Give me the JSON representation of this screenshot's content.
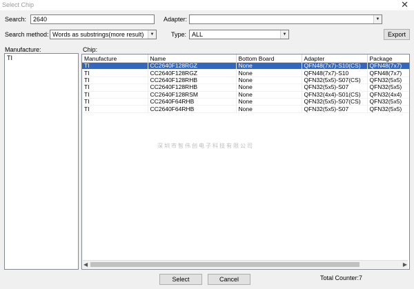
{
  "window": {
    "title": "Select Chip",
    "close_glyph": "✕"
  },
  "search": {
    "label": "Search:",
    "value": "2640"
  },
  "adapter": {
    "label": "Adapter:",
    "value": ""
  },
  "search_method": {
    "label": "Search method:",
    "value": "Words as substrings(more result)"
  },
  "type": {
    "label": "Type:",
    "value": "ALL"
  },
  "export_label": "Export",
  "manufacture": {
    "label": "Manufacture:",
    "items": [
      "TI"
    ]
  },
  "chip": {
    "label": "Chip:",
    "columns": [
      "Manufacture",
      "Name",
      "Bottom Board",
      "Adapter",
      "Package"
    ],
    "rows": [
      [
        "TI",
        "CC2640F128RGZ",
        "None",
        "QFN48(7x7)-S10(CS)",
        "QFN48(7x7)"
      ],
      [
        "TI",
        "CC2640F128RGZ",
        "None",
        "QFN48(7x7)-S10",
        "QFN48(7x7)"
      ],
      [
        "TI",
        "CC2640F128RHB",
        "None",
        "QFN32(5x5)-S07(CS)",
        "QFN32(5x5)"
      ],
      [
        "TI",
        "CC2640F128RHB",
        "None",
        "QFN32(5x5)-S07",
        "QFN32(5x5)"
      ],
      [
        "TI",
        "CC2640F128RSM",
        "None",
        "QFN32(4x4)-S01(CS)",
        "QFN32(4x4)"
      ],
      [
        "TI",
        "CC2640F64RHB",
        "None",
        "QFN32(5x5)-S07(CS)",
        "QFN32(5x5)"
      ],
      [
        "TI",
        "CC2640F64RHB",
        "None",
        "QFN32(5x5)-S07",
        "QFN32(5x5)"
      ]
    ]
  },
  "watermark": "深圳市智伟创电子科技有限公司",
  "select_label": "Select",
  "cancel_label": "Cancel",
  "counter": "Total Counter:7",
  "icons": {
    "dropdown": "▼",
    "scroll_left": "◀",
    "scroll_right": "▶"
  }
}
